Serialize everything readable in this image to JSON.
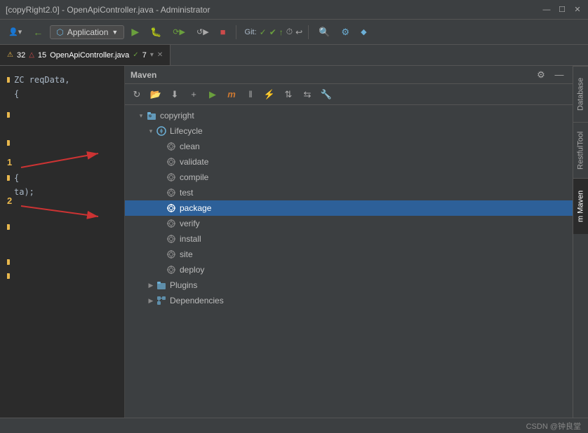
{
  "titleBar": {
    "text": "[copyRight2.0] - OpenApiController.java - Administrator",
    "minBtn": "—",
    "maxBtn": "☐",
    "closeBtn": "✕"
  },
  "mainToolbar": {
    "appLabel": "Application",
    "gitLabel": "Git:",
    "runIcon": "▶",
    "bugIcon": "🐛",
    "buildIcon": "🔨",
    "reloadIcon": "↺",
    "stopIcon": "■",
    "searchIcon": "🔍",
    "settingsIcon": "⚙"
  },
  "tabBar": {
    "tab1Label": "OpenApiController.java",
    "tab1Warnings": "32",
    "tab1Errors": "15",
    "tab1Fixes": "7"
  },
  "mavenPanel": {
    "title": "Maven",
    "treeItems": [
      {
        "id": "copyright",
        "label": "copyright",
        "depth": 0,
        "hasArrow": true,
        "arrowDown": true,
        "icon": "folder"
      },
      {
        "id": "lifecycle",
        "label": "Lifecycle",
        "depth": 1,
        "hasArrow": true,
        "arrowDown": true,
        "icon": "lifecycle"
      },
      {
        "id": "clean",
        "label": "clean",
        "depth": 2,
        "hasArrow": false,
        "icon": "gear"
      },
      {
        "id": "validate",
        "label": "validate",
        "depth": 2,
        "hasArrow": false,
        "icon": "gear"
      },
      {
        "id": "compile",
        "label": "compile",
        "depth": 2,
        "hasArrow": false,
        "icon": "gear"
      },
      {
        "id": "test",
        "label": "test",
        "depth": 2,
        "hasArrow": false,
        "icon": "gear"
      },
      {
        "id": "package",
        "label": "package",
        "depth": 2,
        "hasArrow": false,
        "icon": "gear",
        "selected": true
      },
      {
        "id": "verify",
        "label": "verify",
        "depth": 2,
        "hasArrow": false,
        "icon": "gear"
      },
      {
        "id": "install",
        "label": "install",
        "depth": 2,
        "hasArrow": false,
        "icon": "gear"
      },
      {
        "id": "site",
        "label": "site",
        "depth": 2,
        "hasArrow": false,
        "icon": "gear"
      },
      {
        "id": "deploy",
        "label": "deploy",
        "depth": 2,
        "hasArrow": false,
        "icon": "gear"
      },
      {
        "id": "plugins",
        "label": "Plugins",
        "depth": 1,
        "hasArrow": true,
        "arrowDown": false,
        "icon": "plugins"
      },
      {
        "id": "dependencies",
        "label": "Dependencies",
        "depth": 1,
        "hasArrow": true,
        "arrowDown": false,
        "icon": "dependencies"
      }
    ]
  },
  "rightSidebar": {
    "tabs": [
      {
        "id": "database",
        "label": "Database"
      },
      {
        "id": "restfultool",
        "label": "RestfulTool"
      },
      {
        "id": "maven",
        "label": "m Maven",
        "active": true
      }
    ]
  },
  "codeLines": [
    {
      "num": "",
      "code": "ZC reqData,"
    },
    {
      "num": "",
      "code": "{"
    },
    {
      "num": "1",
      "annotation": "1"
    },
    {
      "num": "2",
      "annotation": "2"
    },
    {
      "num": "",
      "code": ""
    },
    {
      "num": "",
      "code": "{"
    },
    {
      "num": "",
      "code": "ta);"
    }
  ],
  "annotations": {
    "label1": "1",
    "label2": "2"
  },
  "statusBar": {
    "text": "CSDN @钟良堂"
  }
}
